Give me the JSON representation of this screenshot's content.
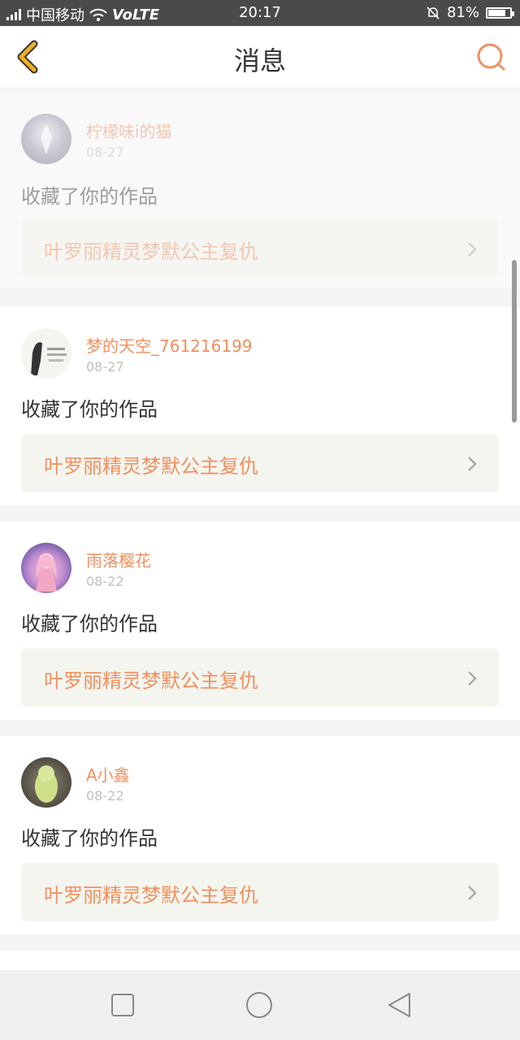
{
  "status_bar": {
    "network_type": "4G",
    "carrier": "中国移动",
    "volte": "VoLTE",
    "time": "20:17",
    "battery": "81%",
    "battery_level": 0.81
  },
  "header": {
    "title": "消息",
    "back_icon": "chevron-left-icon",
    "search_icon": "search-icon"
  },
  "messages": [
    {
      "username": "柠檬味i的猫",
      "date": "08-27",
      "action": "收藏了你的作品",
      "work_title": "叶罗丽精灵梦默公主复仇"
    },
    {
      "username": "梦的天空_761216199",
      "date": "08-27",
      "action": "收藏了你的作品",
      "work_title": "叶罗丽精灵梦默公主复仇"
    },
    {
      "username": "雨落樱花",
      "date": "08-22",
      "action": "收藏了你的作品",
      "work_title": "叶罗丽精灵梦默公主复仇"
    },
    {
      "username": "A小鑫",
      "date": "08-22",
      "action": "收藏了你的作品",
      "work_title": "叶罗丽精灵梦默公主复仇"
    }
  ],
  "colors": {
    "accent": "#f09060",
    "back_icon": "#f0b020",
    "card_bg": "#ffffff",
    "work_bg": "#f5f5ef"
  }
}
